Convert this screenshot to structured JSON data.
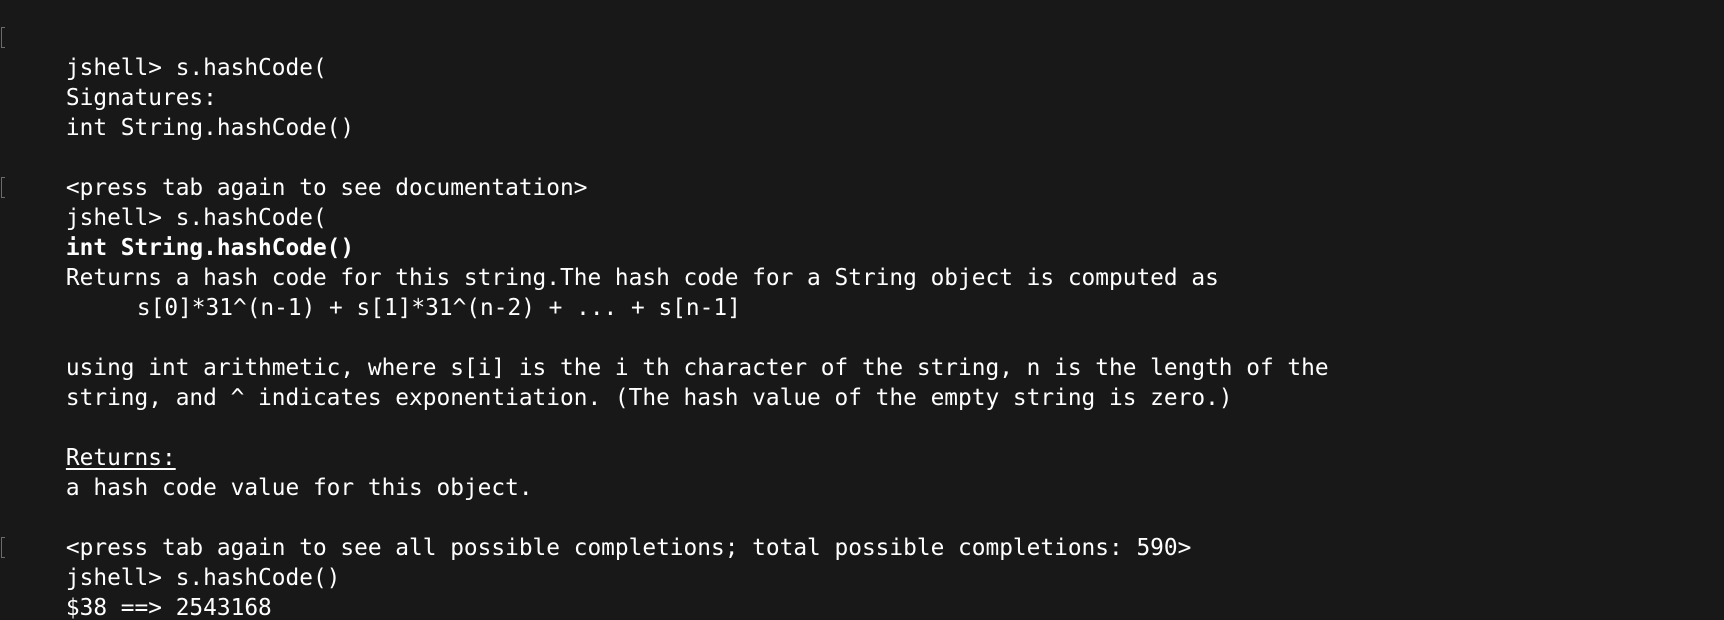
{
  "terminal": {
    "lines": [
      {
        "text": "jshell> s.hashCode(",
        "marker": true
      },
      {
        "text": "Signatures:"
      },
      {
        "text": "int String.hashCode()"
      },
      {
        "text": ""
      },
      {
        "text": "<press tab again to see documentation>"
      },
      {
        "text": "jshell> s.hashCode(",
        "marker": true
      },
      {
        "text": "int String.hashCode()",
        "style": "bold"
      },
      {
        "text": "Returns a hash code for this string.The hash code for a String object is computed as"
      },
      {
        "text": "s[0]*31^(n-1) + s[1]*31^(n-2) + ... + s[n-1]",
        "style": "indent"
      },
      {
        "text": ""
      },
      {
        "text": "using int arithmetic, where s[i] is the i th character of the string, n is the length of the"
      },
      {
        "text": "string, and ^ indicates exponentiation. (The hash value of the empty string is zero.)"
      },
      {
        "text": ""
      },
      {
        "text": "Returns:",
        "style": "underline"
      },
      {
        "text": "a hash code value for this object."
      },
      {
        "text": ""
      },
      {
        "text": "<press tab again to see all possible completions; total possible completions: 590>"
      },
      {
        "text": "jshell> s.hashCode()",
        "marker": true
      },
      {
        "text": "$38 ==> 2543168"
      }
    ]
  }
}
